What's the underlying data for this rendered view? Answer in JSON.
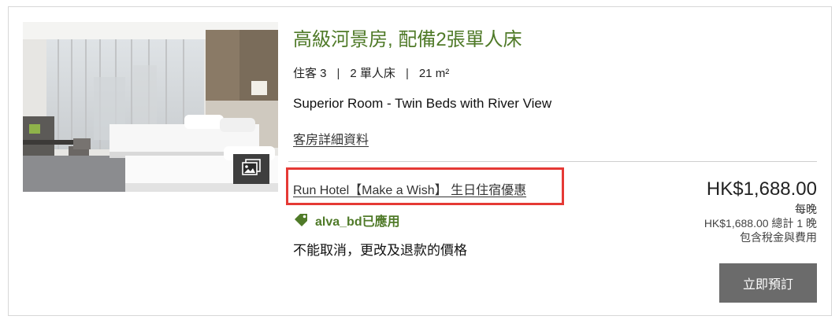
{
  "room": {
    "title": "高級河景房, 配備2張單人床",
    "meta": {
      "guests": "住客 3",
      "beds": "2 單人床",
      "size": "21 m²",
      "separator": "|"
    },
    "name_en": "Superior Room - Twin Beds with River View",
    "details_link": "客房詳細資料"
  },
  "rate": {
    "name": "Run Hotel【Make a Wish】 生日住宿優惠",
    "promo_code": "alva_bd已應用",
    "policy": "不能取消，更改及退款的價格"
  },
  "price": {
    "amount": "HK$1,688.00",
    "per_night": "每晚",
    "total": "HK$1,688.00 總計 1 晚",
    "tax_note": "包含稅金與費用"
  },
  "actions": {
    "book_label": "立即預訂"
  },
  "icons": {
    "gallery": "image-gallery-icon",
    "promo": "price-tag-icon"
  },
  "colors": {
    "title_green": "#4f7a28",
    "highlight_red": "#e53935",
    "button_gray": "#6b6b6b"
  }
}
